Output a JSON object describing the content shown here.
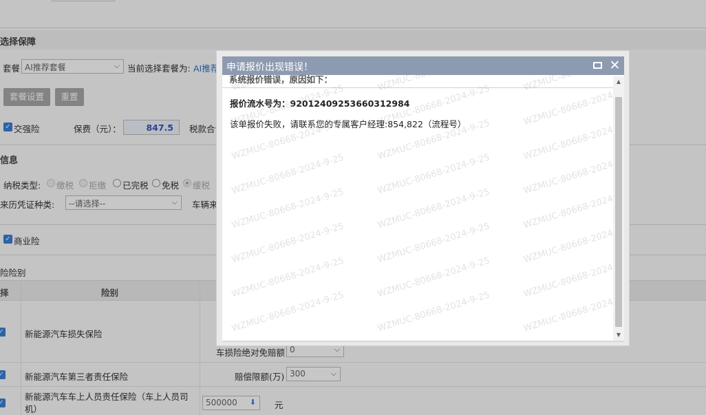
{
  "form": {
    "section_package": {
      "title": "选择保障"
    },
    "package_label": "套餐",
    "package_select": "AI推荐套餐",
    "current_package_label": "当前选择套餐为:",
    "current_package_value": "AI推荐套",
    "btn_package_settings": "套餐设置",
    "btn_reset": "重置",
    "compulsory_label": "交强险",
    "premium_label": "保费（元）：",
    "premium_value": "847.5",
    "tax_total_label": "税款合计",
    "section_tax": {
      "title": "信息"
    },
    "tax_type_label": "纳税类型:",
    "tax_options": [
      "缴税",
      "拒缴",
      "已完税",
      "免税",
      "缓税"
    ],
    "origin_doc_label": "来历凭证种类:",
    "origin_doc_select": "--请选择--",
    "vehicle_origin_label": "车辆来",
    "commercial_label": "商业险",
    "risk_category_label": "险险别",
    "table": {
      "col_select": "择",
      "col_category": "险别",
      "rows": [
        {
          "name": "新能源汽车损失保险"
        },
        {
          "name": "新能源汽车第三者责任保险"
        },
        {
          "name": "新能源汽车车上人员责任保险（车上人员司机）"
        }
      ],
      "deductible_label": "车损险绝对免赔额",
      "deductible_value": "0",
      "liability_label": "赔偿限额(万)",
      "liability_value": "300",
      "seat_value": "500000",
      "seat_unit": "元"
    }
  },
  "dialog": {
    "title": "申请报价出现错误！",
    "hidden_line": "系统报价错误，原因如下：",
    "serial_label": "报价流水号为：",
    "serial_value": "92012409253660312984",
    "message": "该单报价失败，请联系您的专属客户经理:854,822（流程号）",
    "watermark": "WZMUC-80668-2024-9-25"
  },
  "icons": {
    "maximize": "maximize-icon",
    "close": "close-icon",
    "scroll_up": "triangle-up-icon",
    "scroll_down": "triangle-down-icon",
    "dropdown": "chevron-down-icon",
    "checkbox": "checkbox-checked-icon"
  },
  "colors": {
    "titlebar": "#8d9bb1",
    "checkbox": "#3b7fd6",
    "link": "#2a73c8"
  }
}
